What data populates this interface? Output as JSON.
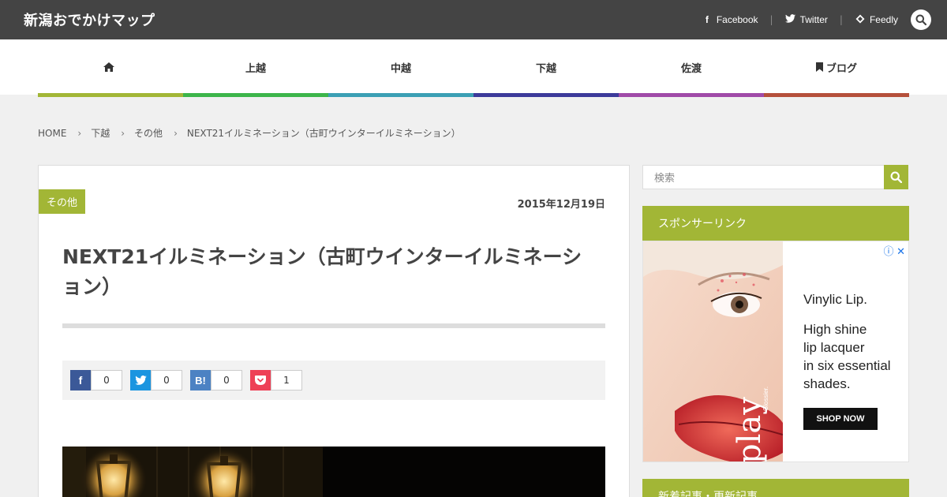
{
  "header": {
    "site_title": "新潟おでかけマップ",
    "social": [
      {
        "label": "Facebook",
        "icon": "facebook-icon"
      },
      {
        "label": "Twitter",
        "icon": "twitter-icon"
      },
      {
        "label": "Feedly",
        "icon": "feedly-icon"
      }
    ]
  },
  "nav": {
    "items": [
      {
        "label": "",
        "icon": "home-icon",
        "color": "#a2b636"
      },
      {
        "label": "上越",
        "color": "#a2b636"
      },
      {
        "label": "中越",
        "color": "#3cb54a"
      },
      {
        "label": "下越",
        "color": "#3b9fb4"
      },
      {
        "label": "佐渡",
        "color": "#3c3a9a"
      },
      {
        "label": "",
        "color": "#a04aa8"
      },
      {
        "label": "ブログ",
        "icon": "bookmark-icon",
        "color": "#b5503b"
      }
    ]
  },
  "breadcrumb": [
    "HOME",
    "下越",
    "その他",
    "NEXT21イルミネーション（古町ウインターイルミネーション）"
  ],
  "article": {
    "category": "その他",
    "date": "2015年12月19日",
    "title": "NEXT21イルミネーション（古町ウインターイルミネーション）",
    "share": [
      {
        "label": "f",
        "count": "0",
        "color": "#3b5998",
        "icon": "facebook-share-icon"
      },
      {
        "label": "t",
        "count": "0",
        "color": "#1b95e0",
        "icon": "twitter-share-icon"
      },
      {
        "label": "B!",
        "count": "0",
        "color": "#4c82c3",
        "icon": "hatena-bookmark-icon"
      },
      {
        "label": "♥",
        "count": "1",
        "color": "#ee4056",
        "icon": "pocket-icon"
      }
    ]
  },
  "sidebar": {
    "search_placeholder": "検索",
    "sponsor_heading": "スポンサーリンク",
    "ad": {
      "line1": "Vinylic Lip.",
      "line2": "High shine",
      "line3": "lip lacquer",
      "line4": "in six essential",
      "line5": "shades.",
      "cta": "SHOP NOW",
      "brand": "play",
      "brand_small": "Glossier."
    },
    "recent_heading": "新着記事・更新記事"
  }
}
